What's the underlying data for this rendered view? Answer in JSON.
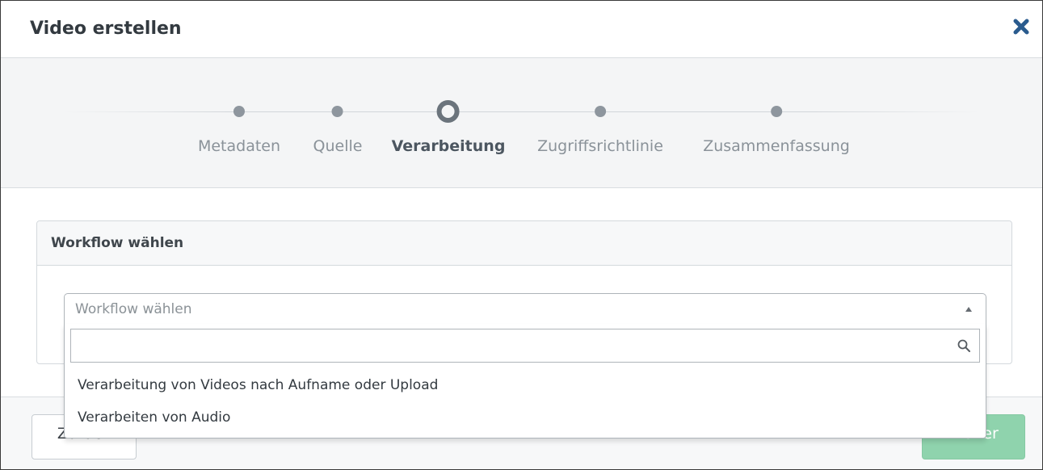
{
  "modal": {
    "title": "Video erstellen",
    "close_icon": "close-icon"
  },
  "wizard": {
    "steps": [
      {
        "label": "Metadaten",
        "active": false
      },
      {
        "label": "Quelle",
        "active": false
      },
      {
        "label": "Verarbeitung",
        "active": true
      },
      {
        "label": "Zugriffsrichtlinie",
        "active": false
      },
      {
        "label": "Zusammenfassung",
        "active": false
      }
    ]
  },
  "workflow_panel": {
    "heading": "Workflow wählen",
    "select": {
      "placeholder": "Workflow wählen",
      "search_value": "",
      "search_icon": "search-icon",
      "options": [
        "Verarbeitung von Videos nach Aufname oder Upload",
        "Verarbeiten von Audio"
      ]
    }
  },
  "footer": {
    "back_label": "Zurück",
    "next_label": "Weiter"
  },
  "colors": {
    "next_button": "#8fd3ad",
    "close_icon": "#2a5b8e",
    "wizard_background": "#f4f5f6"
  }
}
